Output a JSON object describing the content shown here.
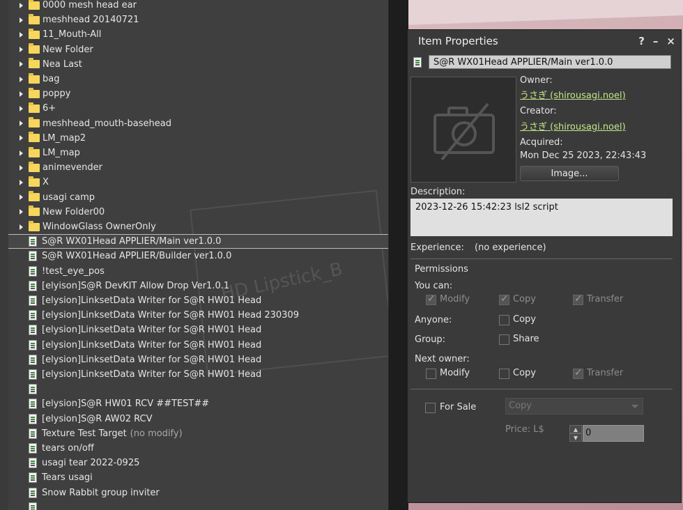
{
  "inventory": {
    "folders": [
      "0000 mesh head ear",
      "meshhead 20140721",
      "11_Mouth-All",
      "New Folder",
      "Nea Last",
      "bag",
      "poppy",
      "6+",
      "meshhead_mouth-basehead",
      "LM_map2",
      "LM_map",
      "animevender",
      "X",
      "usagi camp",
      "New Folder00",
      "WindowGlass OwnerOnly"
    ],
    "items": [
      {
        "label": "S@R WX01Head APPLIER/Main ver1.0.0",
        "suffix": "",
        "selected": true
      },
      {
        "label": "S@R WX01Head APPLIER/Builder ver1.0.0",
        "suffix": ""
      },
      {
        "label": "!test_eye_pos",
        "suffix": ""
      },
      {
        "label": "[elyison]S@R DevKIT Allow Drop Ver1.0.1",
        "suffix": ""
      },
      {
        "label": "[elysion]LinksetData Writer for S@R HW01 Head",
        "suffix": ""
      },
      {
        "label": "[elysion]LinksetData Writer for S@R HW01 Head 230309",
        "suffix": ""
      },
      {
        "label": "[elysion]LinksetData Writer for S@R HW01 Head",
        "suffix": ""
      },
      {
        "label": "[elysion]LinksetData Writer for S@R HW01 Head",
        "suffix": ""
      },
      {
        "label": "[elysion]LinksetData Writer for S@R HW01 Head",
        "suffix": ""
      },
      {
        "label": "[elysion]LinksetData Writer for S@R HW01 Head",
        "suffix": ""
      },
      {
        "label": "",
        "suffix": ""
      },
      {
        "label": "[elysion]S@R HW01 RCV ##TEST##",
        "suffix": ""
      },
      {
        "label": "[elysion]S@R AW02 RCV",
        "suffix": ""
      },
      {
        "label": "Texture Test Target",
        "suffix": "(no modify)"
      },
      {
        "label": "tears on/off",
        "suffix": ""
      },
      {
        "label": "usagi tear 2022-0925",
        "suffix": ""
      },
      {
        "label": "Tears usagi",
        "suffix": ""
      },
      {
        "label": "Snow Rabbit group inviter",
        "suffix": ""
      },
      {
        "label": "",
        "suffix": ""
      }
    ],
    "watermark": "HD Lipstick_B"
  },
  "properties": {
    "title": "Item Properties",
    "help": "?",
    "minimize": "–",
    "close": "×",
    "item_name": "S@R WX01Head APPLIER/Main ver1.0.0",
    "owner_label": "Owner:",
    "owner": "うさぎ (shirousagi.noel)",
    "creator_label": "Creator:",
    "creator": "うさぎ (shirousagi.noel)",
    "acquired_label": "Acquired:",
    "acquired": "Mon Dec 25 2023, 22:43:43",
    "image_button": "Image...",
    "description_label": "Description:",
    "description": "2023-12-26 15:42:23 lsl2 script",
    "experience_label": "Experience:",
    "experience": "(no experience)",
    "permissions_title": "Permissions",
    "you_can": "You can:",
    "modify": "Modify",
    "copy": "Copy",
    "transfer": "Transfer",
    "anyone": "Anyone:",
    "group": "Group:",
    "share": "Share",
    "next_owner": "Next owner:",
    "for_sale": "For Sale",
    "sale_type": "Copy",
    "price_label": "Price: L$",
    "price": "0"
  }
}
